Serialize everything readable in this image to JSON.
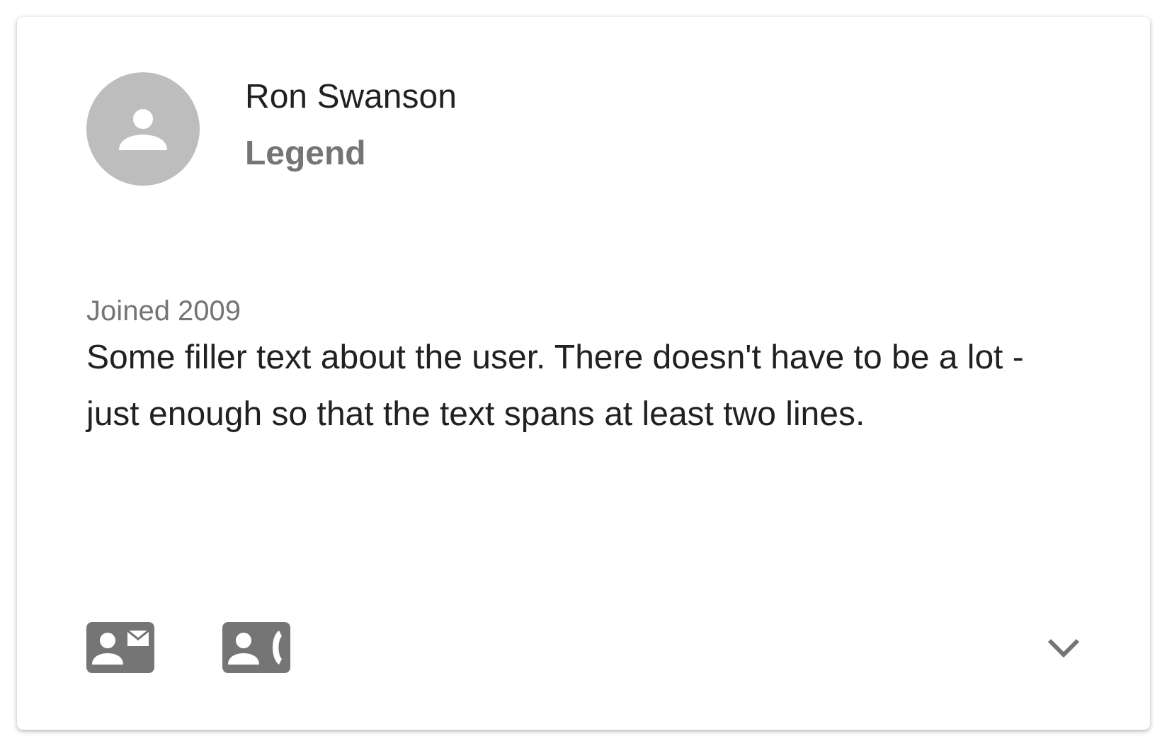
{
  "card": {
    "name": "Ron Swanson",
    "subtitle": "Legend",
    "joined": "Joined 2009",
    "bio": "Some filler text about the user. There doesn't have to be a lot - just enough so that the text spans at least two lines.",
    "actions": [
      {
        "kind": "email"
      },
      {
        "kind": "call"
      }
    ],
    "expanded": false
  }
}
